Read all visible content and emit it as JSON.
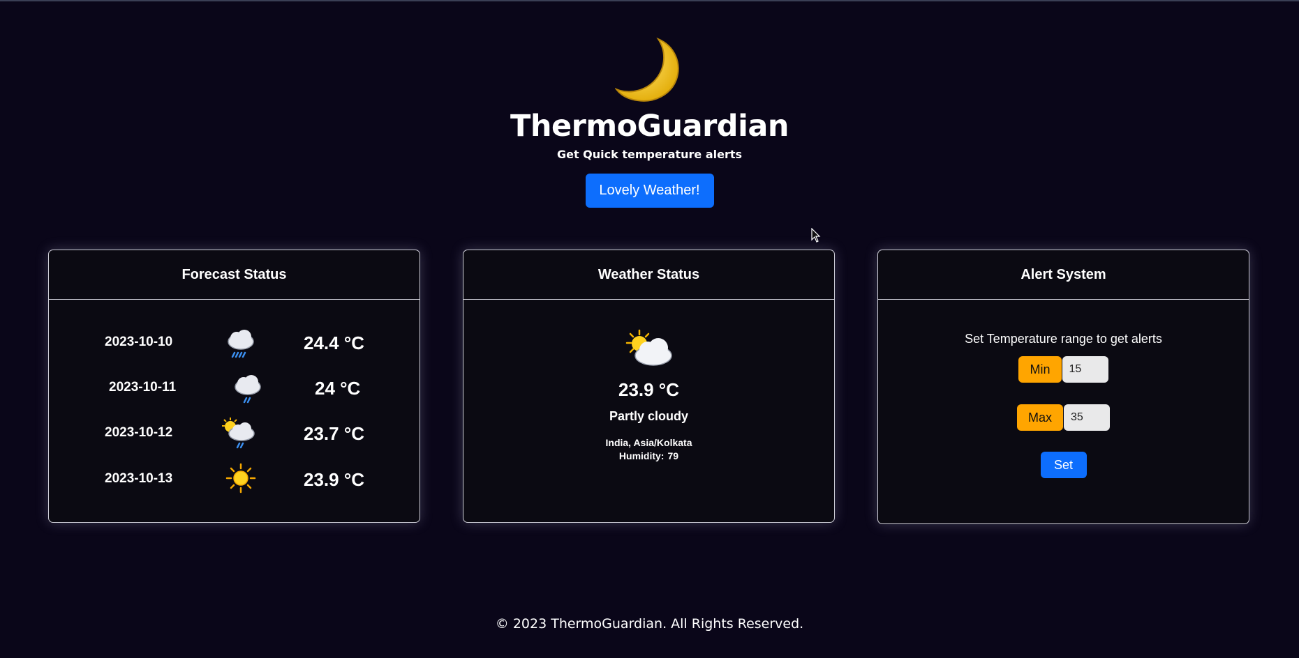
{
  "header": {
    "title": "ThermoGuardian",
    "subtitle": "Get Quick temperature alerts",
    "hero_button_label": "Lovely Weather!",
    "logo_icon": "crescent-moon-icon"
  },
  "forecast": {
    "title": "Forecast Status",
    "rows": [
      {
        "date": "2023-10-10",
        "icon": "rain-cloud-icon",
        "temp": "24.4 °C"
      },
      {
        "date": "2023-10-11",
        "icon": "light-rain-cloud-icon",
        "temp": "24 °C"
      },
      {
        "date": "2023-10-12",
        "icon": "sun-cloud-rain-icon",
        "temp": "23.7 °C"
      },
      {
        "date": "2023-10-13",
        "icon": "sun-icon",
        "temp": "23.9 °C"
      }
    ]
  },
  "weather": {
    "title": "Weather Status",
    "icon": "partly-cloudy-icon",
    "temp": "23.9 °C",
    "condition": "Partly cloudy",
    "location": "India, Asia/Kolkata",
    "humidity_label": "Humidity:",
    "humidity_value": "79"
  },
  "alerts": {
    "title": "Alert System",
    "instruction": "Set Temperature range to get alerts",
    "min_label": "Min",
    "min_value": "15",
    "max_label": "Max",
    "max_value": "35",
    "set_label": "Set"
  },
  "footer": {
    "text": "© 2023 ThermoGuardian. All Rights Reserved."
  },
  "colors": {
    "background": "#0a0619",
    "accent_blue": "#0d6efd",
    "accent_orange": "#ffa500"
  }
}
